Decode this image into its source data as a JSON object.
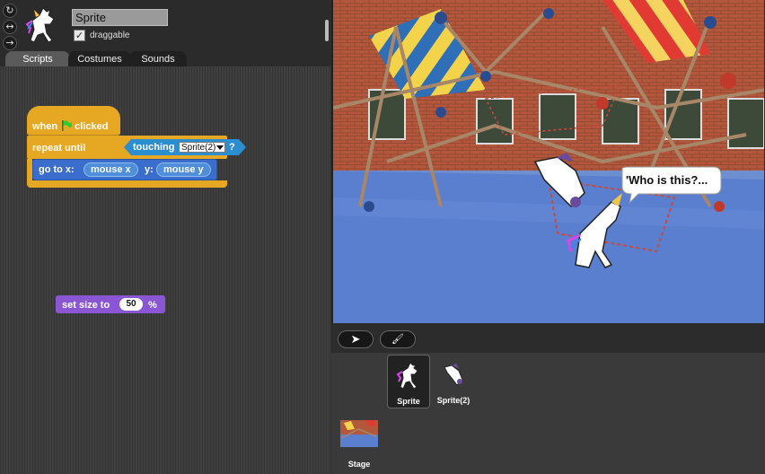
{
  "sprite_panel": {
    "rotation_buttons": [
      "↻",
      "↔",
      "→"
    ],
    "sprite_name": "Sprite",
    "draggable_label": "draggable",
    "draggable_checked": "✓"
  },
  "tabs": [
    {
      "label": "Scripts"
    },
    {
      "label": "Costumes"
    },
    {
      "label": "Sounds"
    }
  ],
  "scripts": {
    "hat_when": "when",
    "hat_clicked": "clicked",
    "repeat_until": "repeat until",
    "touching": "touching",
    "touching_target": "Sprite(2)",
    "question": "?",
    "go_to_x": "go to x:",
    "mouse_x": "mouse x",
    "y_label": "y:",
    "mouse_y": "mouse y",
    "set_size": "set size to",
    "size_value": "50",
    "percent": "%"
  },
  "stage": {
    "speech_bubble": "'Who is this?..."
  },
  "stage_tools": {
    "pointer_label": "➤",
    "paint_label": "🖌"
  },
  "corral": {
    "sprites": [
      {
        "name": "Sprite"
      },
      {
        "name": "Sprite(2)"
      }
    ],
    "stage_label": "Stage"
  },
  "colors": {
    "control": "#e6a822",
    "motion": "#3b6ecc",
    "sensing": "#2b8ed1",
    "looks": "#8a56d3"
  }
}
